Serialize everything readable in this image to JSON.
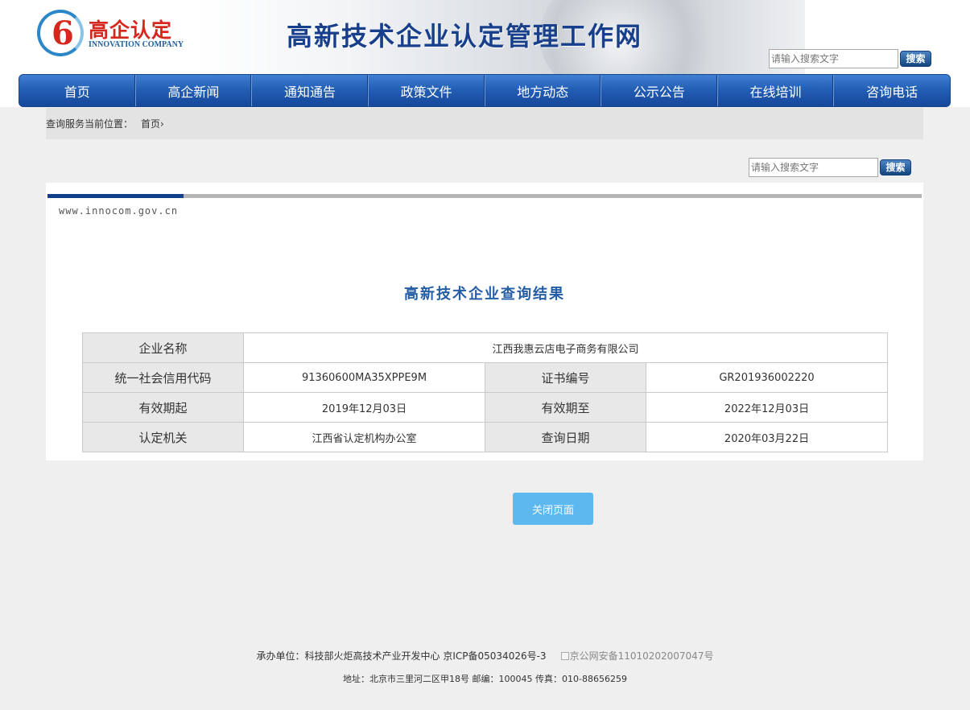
{
  "header": {
    "logo_cn": "高企认定",
    "logo_en": "INNOVATION COMPANY",
    "logo_mark": "6",
    "site_title": "高新技术企业认定管理工作网",
    "search_placeholder": "请输入搜索文字",
    "search_button": "搜索"
  },
  "nav": {
    "items": [
      "首页",
      "高企新闻",
      "通知通告",
      "政策文件",
      "地方动态",
      "公示公告",
      "在线培训",
      "咨询电话"
    ]
  },
  "breadcrumb": {
    "label": "查询服务当前位置：",
    "home": "首页",
    "separator": "›"
  },
  "search2": {
    "placeholder": "请输入搜索文字",
    "button": "搜索"
  },
  "panel": {
    "site_url": "www.innocom.gov.cn",
    "title": "高新技术企业查询结果"
  },
  "result": {
    "company_name_label": "企业名称",
    "company_name": "江西我惠云店电子商务有限公司",
    "credit_code_label": "统一社会信用代码",
    "credit_code": "91360600MA35XPPE9M",
    "cert_no_label": "证书编号",
    "cert_no": "GR201936002220",
    "valid_from_label": "有效期起",
    "valid_from": "2019年12月03日",
    "valid_to_label": "有效期至",
    "valid_to": "2022年12月03日",
    "authority_label": "认定机关",
    "authority": "江西省认定机构办公室",
    "query_date_label": "查询日期",
    "query_date": "2020年03月22日"
  },
  "actions": {
    "close_button": "关闭页面"
  },
  "footer": {
    "organizer": "承办单位：科技部火炬高技术产业开发中心 京ICP备05034026号-3",
    "police_record": "京公网安备11010202007047号",
    "address": "地址：北京市三里河二区甲18号 邮编：100045 传真：010-88656259"
  },
  "colors": {
    "nav_blue": "#245fb6",
    "title_blue": "#245ea6",
    "close_button": "#5cb8ef",
    "logo_red": "#d6271e"
  }
}
